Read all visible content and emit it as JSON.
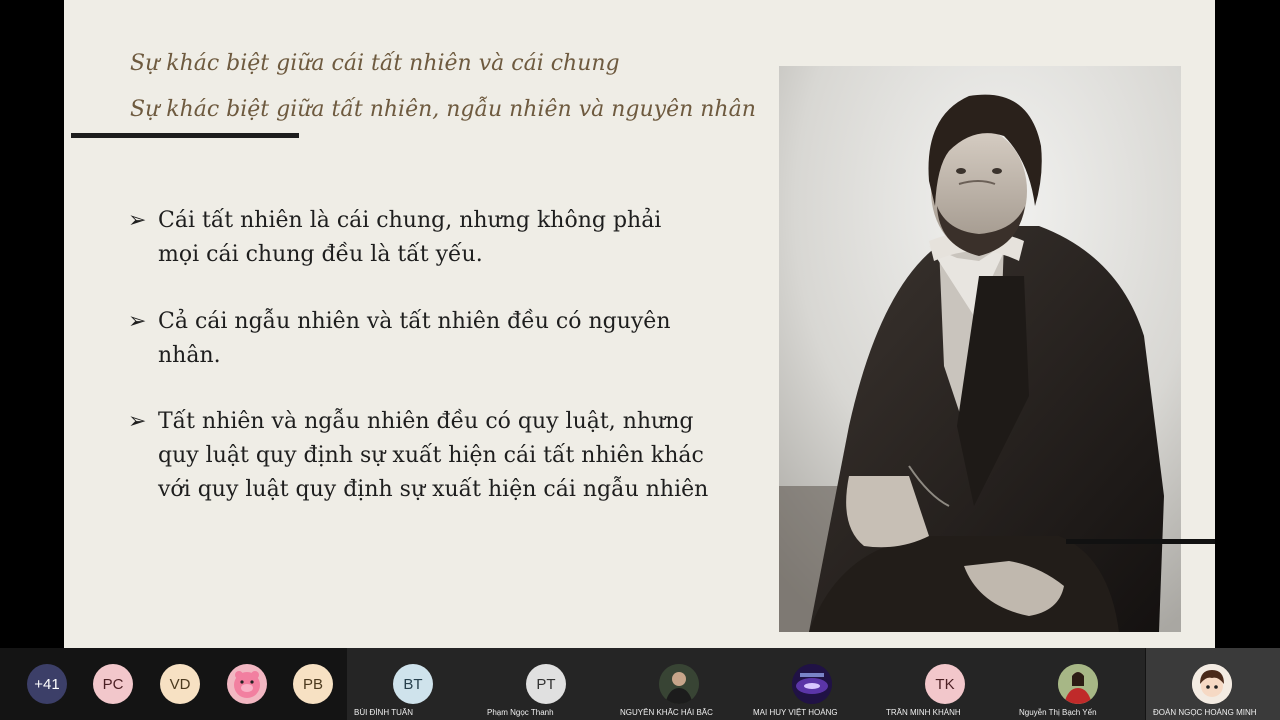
{
  "slide": {
    "heading_1": "Sự khác biệt giữa cái tất nhiên và cái chung",
    "heading_2": "Sự khác biệt giữa tất nhiên, ngẫu nhiên và nguyên nhân",
    "bullet_marker": "➢",
    "bullets": [
      {
        "line_1": "Cái tất nhiên là cái chung, nhưng không phải",
        "line_2": "mọi cái chung đều là tất yếu."
      },
      {
        "line_1": "Cả cái ngẫu nhiên và tất nhiên đều có nguyên",
        "line_2": "nhân."
      },
      {
        "line_1": "Tất nhiên và ngẫu nhiên đều có quy luật, nhưng",
        "line_2": "quy luật quy định sự xuất hiện cái tất nhiên khác",
        "line_3": "với quy luật quy định sự xuất hiện cái ngẫu nhiên"
      }
    ]
  },
  "participants": {
    "more_count": "+41",
    "small_avatars": [
      "PC",
      "VD",
      "PB"
    ],
    "tiles": [
      {
        "initials": "BT",
        "name": "BÙI ĐÌNH TUẤN"
      },
      {
        "initials": "PT",
        "name": "Phạm Ngọc Thanh"
      },
      {
        "initials": "",
        "name": "NGUYỄN KHẮC HẢI BẮC"
      },
      {
        "initials": "",
        "name": "MAI HUY VIỆT HOÀNG"
      },
      {
        "initials": "TK",
        "name": "TRẦN MINH KHÁNH"
      },
      {
        "initials": "",
        "name": "Nguyễn Thị Bạch Yến"
      },
      {
        "initials": "",
        "name": "ĐOÀN NGỌC HOÀNG MINH"
      }
    ]
  },
  "colors": {
    "slide_background": "#efede6",
    "heading_color": "#6e5a3f",
    "body_text": "#1e1e1e",
    "participant_bar": "#141414",
    "more_badge": "#3c3f68"
  }
}
